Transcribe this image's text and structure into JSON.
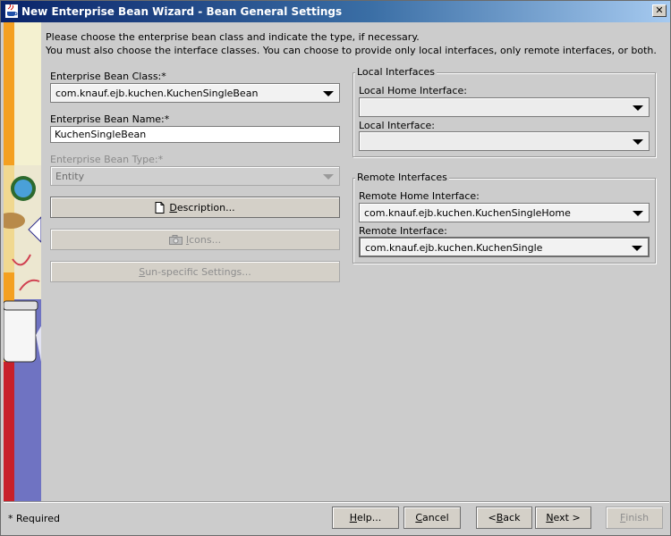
{
  "window": {
    "title": "New Enterprise Bean Wizard - Bean General Settings"
  },
  "intro": {
    "line1": "Please choose the enterprise bean class and indicate the type, if necessary.",
    "line2": "You must also choose the interface classes.  You can choose to provide only local interfaces, only remote interfaces, or both."
  },
  "form": {
    "bean_class_label": "Enterprise Bean Class:*",
    "bean_class_value": "com.knauf.ejb.kuchen.KuchenSingleBean",
    "bean_name_label": "Enterprise Bean Name:*",
    "bean_name_value": "KuchenSingleBean",
    "bean_type_label": "Enterprise Bean Type:*",
    "bean_type_value": "Entity",
    "description_button": {
      "pre": "",
      "u": "D",
      "post": "escription..."
    },
    "icons_button": {
      "pre": "",
      "u": "I",
      "post": "cons..."
    },
    "sun_button": {
      "pre": "",
      "u": "S",
      "post": "un-specific Settings..."
    }
  },
  "local": {
    "group_title": "Local Interfaces",
    "home_label": "Local Home Interface:",
    "home_value": "",
    "iface_label": "Local Interface:",
    "iface_value": ""
  },
  "remote": {
    "group_title": "Remote Interfaces",
    "home_label": "Remote Home Interface:",
    "home_value": "com.knauf.ejb.kuchen.KuchenSingleHome",
    "iface_label": "Remote Interface:",
    "iface_value": "com.knauf.ejb.kuchen.KuchenSingle"
  },
  "footer": {
    "required_note": "* Required",
    "help": {
      "pre": "",
      "u": "H",
      "post": "elp..."
    },
    "cancel": {
      "pre": "",
      "u": "C",
      "post": "ancel"
    },
    "back": {
      "pre": "< ",
      "u": "B",
      "post": "ack"
    },
    "next": {
      "pre": "",
      "u": "N",
      "post": "ext >"
    },
    "finish": {
      "pre": "",
      "u": "F",
      "post": "inish"
    }
  },
  "colors": {
    "title_start": "#0a246a",
    "title_end": "#a6caf0",
    "window_bg": "#cccccc"
  }
}
